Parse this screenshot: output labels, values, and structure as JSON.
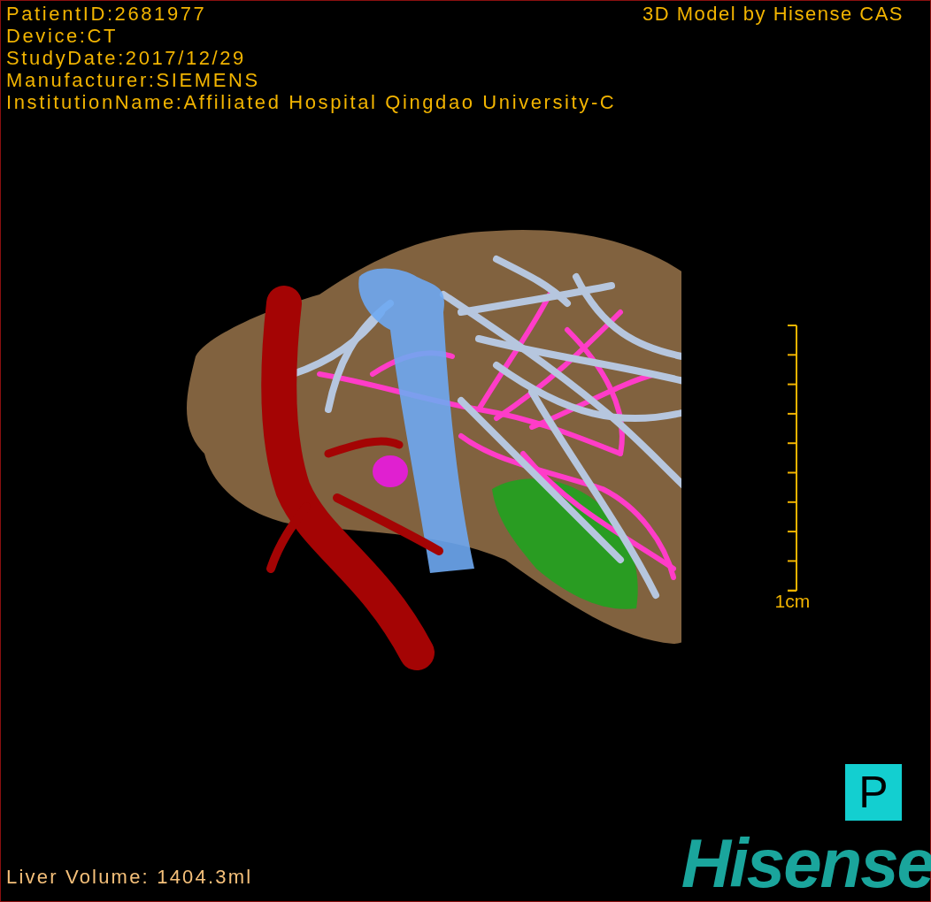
{
  "patient_info": [
    "PatientID:2681977",
    "Device:CT",
    "StudyDate:2017/12/29",
    "Manufacturer:SIEMENS",
    "InstitutionName:Affiliated Hospital Qingdao University-C"
  ],
  "title": "3D Model by Hisense CAS",
  "scale_bar": {
    "label": "1cm"
  },
  "orientation": "P",
  "liver_volume": "Liver Volume: 1404.3ml",
  "logo": "Hisense"
}
